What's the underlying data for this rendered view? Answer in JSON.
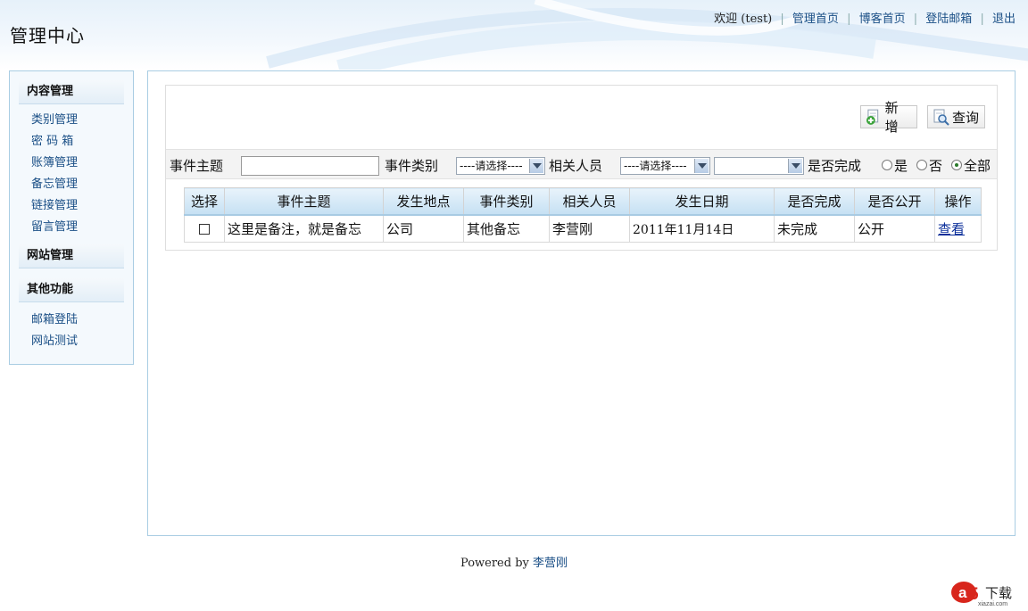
{
  "header": {
    "title": "管理中心",
    "welcome": "欢迎 (test)",
    "links": [
      "管理首页",
      "博客首页",
      "登陆邮箱",
      "退出"
    ]
  },
  "sidebar": {
    "sections": [
      {
        "title": "内容管理",
        "items": [
          "类别管理",
          "密 码 箱",
          "账簿管理",
          "备忘管理",
          "链接管理",
          "留言管理"
        ]
      },
      {
        "title": "网站管理",
        "items": []
      },
      {
        "title": "其他功能",
        "items": [
          "邮箱登陆",
          "网站测试"
        ]
      }
    ]
  },
  "toolbar": {
    "add_label": "新增",
    "query_label": "查询"
  },
  "filters": {
    "subject_label": "事件主题",
    "subject_value": "",
    "category_label": "事件类别",
    "category_value": "----请选择----",
    "person_label": "相关人员",
    "person_value": "----请选择----",
    "extra_value": "",
    "done_label": "是否完成",
    "radio_yes": "是",
    "radio_no": "否",
    "radio_all": "全部",
    "radio_selected": "全部"
  },
  "table": {
    "headers": [
      "选择",
      "事件主题",
      "发生地点",
      "事件类别",
      "相关人员",
      "发生日期",
      "是否完成",
      "是否公开",
      "操作"
    ],
    "rows": [
      {
        "selected": false,
        "subject": "这里是备注，就是备忘",
        "place": "公司",
        "category": "其他备忘",
        "person": "李营刚",
        "date": "2011年11月14日",
        "done": "未完成",
        "public": "公开",
        "action": "查看"
      }
    ]
  },
  "footer": {
    "powered_by": "Powered by",
    "author": "李营刚"
  },
  "watermark": {
    "brand": "下载",
    "site": "xiazai.com"
  },
  "colors": {
    "link": "#1a4f86",
    "border": "#a9cde3",
    "table_header": "#c5e0f3"
  }
}
